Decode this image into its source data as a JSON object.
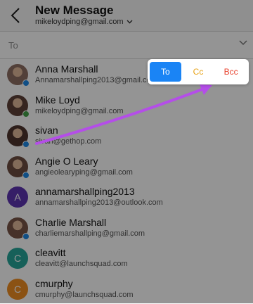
{
  "header": {
    "title": "New Message",
    "account": "mikeloydping@gmail.com"
  },
  "to_field": {
    "label": "To"
  },
  "contacts": [
    {
      "name": "Anna Marshall",
      "email": "Annamarshallping2013@gmail.com",
      "avatar": "photo",
      "initial": "",
      "presence": "#1e88e5"
    },
    {
      "name": "Mike Loyd",
      "email": "mikeloydping@gmail.com",
      "avatar": "photo",
      "initial": "",
      "presence": "#43a047"
    },
    {
      "name": "sivan",
      "email": "sivan@gethop.com",
      "avatar": "photo",
      "initial": "",
      "presence": "#1e88e5"
    },
    {
      "name": "Angie O Leary",
      "email": "angieolearyping@gmail.com",
      "avatar": "photo",
      "initial": "",
      "presence": "#1e88e5"
    },
    {
      "name": "annamarshallping2013",
      "email": "annamarshallping2013@outlook.com",
      "avatar": "initial",
      "initial": "A",
      "presence": ""
    },
    {
      "name": "Charlie Marshall",
      "email": "charliemarshallping@gmail.com",
      "avatar": "photo",
      "initial": "",
      "presence": "#1e88e5"
    },
    {
      "name": "cleavitt",
      "email": "cleavitt@launchsquad.com",
      "avatar": "initial",
      "initial": "C",
      "presence": ""
    },
    {
      "name": "cmurphy",
      "email": "cmurphy@launchsquad.com",
      "avatar": "initial",
      "initial": "C",
      "presence": ""
    }
  ],
  "recipient_popup": {
    "options": [
      {
        "label": "To",
        "color": "#1a84f5",
        "active": true
      },
      {
        "label": "Cc",
        "color": "#e8a317",
        "active": false
      },
      {
        "label": "Bcc",
        "color": "#e8412c",
        "active": false
      }
    ]
  },
  "colors": {
    "accent": "#1a84f5",
    "arrow": "#b44ee8",
    "avatar_purple": "#5e35b1",
    "avatar_teal": "#26a69a",
    "avatar_orange": "#ef8d22"
  },
  "icons": {
    "back": "chevron-left-icon",
    "account_dropdown": "chevron-down-icon",
    "to_expand": "chevron-down-icon"
  }
}
